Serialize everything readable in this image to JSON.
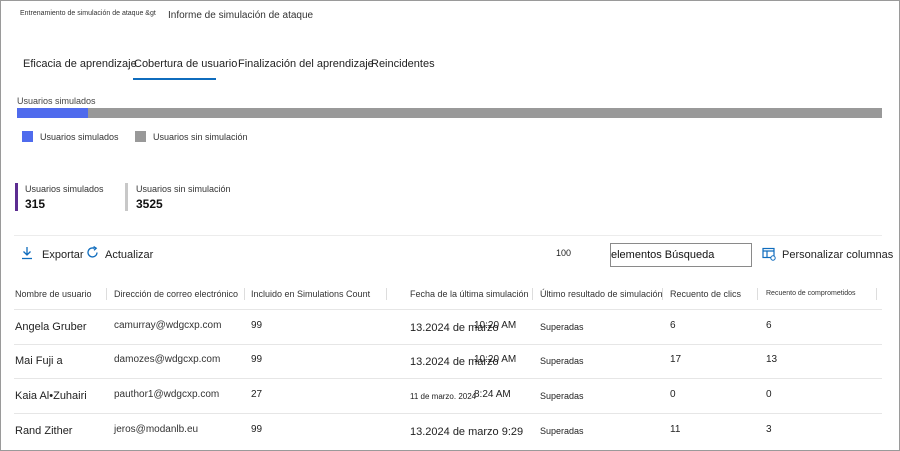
{
  "breadcrumb": {
    "parent": "Entrenamiento de simulación de ataque &gt",
    "current": "Informe de simulación de ataque"
  },
  "tabs": [
    {
      "label": "Eficacia de aprendizaje",
      "selected": false
    },
    {
      "label": "Cobertura de usuario",
      "selected": true
    },
    {
      "label": "Finalización del aprendizaje",
      "selected": false
    },
    {
      "label": "Reincidentes",
      "selected": false
    }
  ],
  "coverage": {
    "bar_label": "Usuarios simulados",
    "simulated_fraction": 0.0821,
    "colors": {
      "simulated": "#4f6bed",
      "not_simulated": "#999999"
    },
    "legend": [
      {
        "label": "Usuarios simulados",
        "color": "#4f6bed"
      },
      {
        "label": "Usuarios sin simulación",
        "color": "#999999"
      }
    ]
  },
  "stats": [
    {
      "label": "Usuarios simulados",
      "value": "315",
      "color": "#5c2d91"
    },
    {
      "label": "Usuarios sin simulación",
      "value": "3525",
      "color": "#c8c8c8"
    }
  ],
  "toolbar": {
    "export_label": "Exportar",
    "export_icon": "download-icon",
    "refresh_label": "Actualizar",
    "refresh_icon": "refresh-icon",
    "item_count": "100",
    "search_text": "elementos Búsqueda",
    "customize_label": "Personalizar columnas",
    "customize_icon": "columns-icon"
  },
  "table": {
    "headers": [
      "Nombre de usuario",
      "Dirección de correo electrónico",
      "Incluido en Simulations Count",
      "Fecha de la última simulación",
      "Último resultado de simulación",
      "Recuento de clics",
      "Recuento de comprometidos"
    ],
    "rows": [
      {
        "name": "Angela Gruber",
        "email": "camurray@wdgcxp.com",
        "count": "99",
        "date": "13.2024 de marzo",
        "time": "10:20 AM",
        "result": "Superadas",
        "clicks": "6",
        "compromised": "6"
      },
      {
        "name": "Mai Fuji a",
        "email": "damozes@wdgcxp.com",
        "count": "99",
        "date": "13.2024 de marzo",
        "time": "10:20 AM",
        "result": "Superadas",
        "clicks": "17",
        "compromised": "13"
      },
      {
        "name": "Kaia Al•Zuhairi",
        "email": "pauthor1@wdgcxp.com",
        "count": "27",
        "date": "11 de marzo. 2024",
        "time": "8:24 AM",
        "result": "Superadas",
        "clicks": "0",
        "compromised": "0"
      },
      {
        "name": "Rand Zither",
        "email": "jeros@modanlb.eu",
        "count": "99",
        "date": "13.2024 de marzo 9:29",
        "time": "",
        "result": "Superadas",
        "clicks": "11",
        "compromised": "3"
      }
    ]
  }
}
